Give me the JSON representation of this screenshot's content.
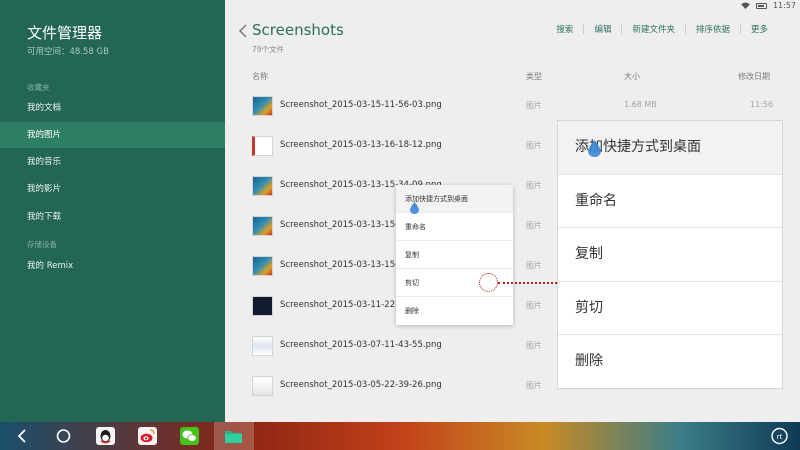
{
  "status_bar": {
    "time": "11:57"
  },
  "sidebar": {
    "app_title": "文件管理器",
    "free_space": "可用空间：48.58 GB",
    "favorites_label": "收藏夹",
    "items": [
      {
        "label": "我的文档"
      },
      {
        "label": "我的图片"
      },
      {
        "label": "我的音乐"
      },
      {
        "label": "我的影片"
      },
      {
        "label": "我的下载"
      }
    ],
    "storage_label": "存储设备",
    "storage_items": [
      {
        "label": "我的 Remix"
      }
    ]
  },
  "header": {
    "title": "Screenshots",
    "file_count": "79个文件"
  },
  "toolbar": {
    "search": "搜索",
    "edit": "编辑",
    "new_folder": "新建文件夹",
    "sort": "排序依据",
    "more": "更多"
  },
  "columns": {
    "name": "名称",
    "type": "类型",
    "size": "大小",
    "modified": "修改日期"
  },
  "files": [
    {
      "name": "Screenshot_2015-03-15-11-56-03.png",
      "type": "图片",
      "size": "1.68 MB",
      "date": "11:56"
    },
    {
      "name": "Screenshot_2015-03-13-16-18-12.png",
      "type": "图片",
      "size": "",
      "date": ""
    },
    {
      "name": "Screenshot_2015-03-13-15-34-09.png",
      "type": "图片",
      "size": "",
      "date": ""
    },
    {
      "name": "Screenshot_2015-03-13-15-3",
      "type": "图片",
      "size": "",
      "date": ""
    },
    {
      "name": "Screenshot_2015-03-13-15-3",
      "type": "图片",
      "size": "",
      "date": ""
    },
    {
      "name": "Screenshot_2015-03-11-22-4",
      "type": "图片",
      "size": "",
      "date": ""
    },
    {
      "name": "Screenshot_2015-03-07-11-43-55.png",
      "type": "图片",
      "size": "",
      "date": ""
    },
    {
      "name": "Screenshot_2015-03-05-22-39-26.png",
      "type": "图片",
      "size": "",
      "date": ""
    }
  ],
  "context_menu": {
    "items": [
      {
        "label": "添加快捷方式到桌面"
      },
      {
        "label": "重命名"
      },
      {
        "label": "复制"
      },
      {
        "label": "剪切"
      },
      {
        "label": "删除"
      }
    ]
  },
  "taskbar": {
    "items": [
      "back-icon",
      "home-icon",
      "qq-icon",
      "weibo-icon",
      "wechat-icon",
      "file-manager-icon",
      "remix-icon"
    ]
  },
  "colors": {
    "sidebar_bg": "#236653",
    "sidebar_active": "#2e7e66",
    "accent": "#2d7060",
    "callout": "#b71c1c"
  }
}
